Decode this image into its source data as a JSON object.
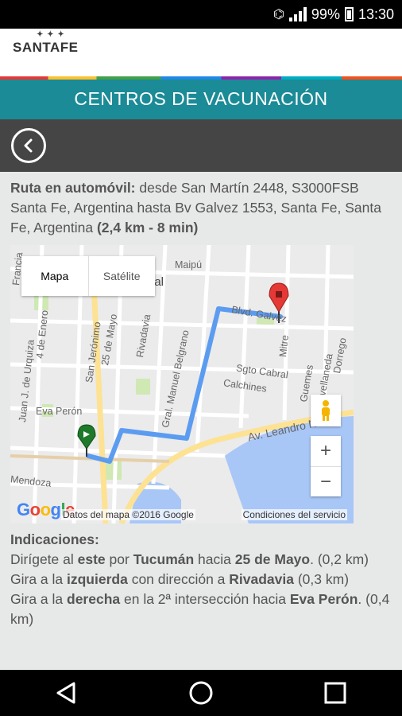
{
  "statusbar": {
    "battery": "99%",
    "time": "13:30"
  },
  "header": {
    "logo_text": "SANTAFE"
  },
  "titlebar": {
    "title": "CENTROS DE VACUNACIÓN"
  },
  "route": {
    "label": "Ruta en automóvil:",
    "text": " desde San Martín 2448, S3000FSB Santa Fe, Argentina hasta Bv Galvez 1553, Santa Fe, Santa Fe, Argentina ",
    "summary": "(2,4 km - 8 min)"
  },
  "map": {
    "type_map": "Mapa",
    "type_satellite": "Satélite",
    "zoom_in": "+",
    "zoom_out": "−",
    "google": "Google",
    "data": "Datos del mapa ©2016 Google",
    "terms": "Condiciones del servicio",
    "streets": {
      "maipu": "Maipú",
      "oral": "oral",
      "galvez": "Blvd. Galvez",
      "sgto": "Sgto Cabral",
      "calchines": "Calchines",
      "leandro": "Av. Leandro N.",
      "evaperon": "Eva Perón",
      "mendoza": "Mendoza",
      "mayo": "25 de Mayo",
      "rivadavia": "Rivadavia",
      "jeronimo": "San Jerónimo",
      "belgrano": "Gral. Manuel Belgrano",
      "urquiza": "Juan J. de Urquiza",
      "enero": "4 de Enero",
      "mitre": "Mitre",
      "guemes": "Guemes",
      "avellaneda": "Avellaneda",
      "dorrego": "Dorrego",
      "francia": "Francia"
    },
    "colors": {
      "route": "#5b9cf1",
      "start": "#1e7a2a",
      "end": "#e53935"
    }
  },
  "directions": {
    "title": "Indicaciones:",
    "steps": [
      {
        "a": "Dirígete al ",
        "b": "este",
        "c": " por ",
        "d": "Tucumán",
        "e": " hacia ",
        "f": "25 de Mayo",
        "g": ". (0,2 km)"
      },
      {
        "a": "Gira a la ",
        "b": "izquierda",
        "c": " con dirección a ",
        "d": "Rivadavia",
        "e": " (0,3 km)"
      },
      {
        "a": "Gira a la ",
        "b": "derecha",
        "c": " en la 2ª intersección hacia ",
        "d": "Eva Perón",
        "e": ". (0,4 km)"
      }
    ]
  }
}
